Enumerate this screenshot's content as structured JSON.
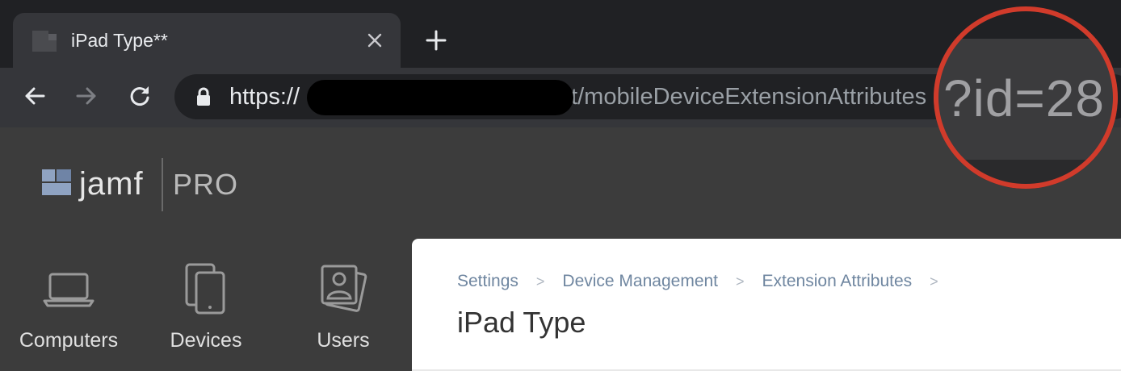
{
  "browser": {
    "tab": {
      "title": "iPad Type**",
      "favicon": "jamf-favicon"
    },
    "buttons": {
      "back_icon": "arrow-left-icon",
      "forward_icon": "arrow-right-icon",
      "reload_icon": "reload-icon",
      "close_icon": "close-icon",
      "new_tab_icon": "plus-icon"
    },
    "url": {
      "scheme": "https://",
      "redacted_host": "",
      "path": "t/mobileDeviceExtensionAttributes",
      "lock_icon": "lock-icon"
    }
  },
  "callout": {
    "text": "?id=28",
    "ring_color": "#d13b2b"
  },
  "app": {
    "logo": {
      "word": "jamf",
      "pro": "PRO"
    },
    "nav": [
      {
        "label": "Computers",
        "icon": "laptop-icon"
      },
      {
        "label": "Devices",
        "icon": "mobile-devices-icon"
      },
      {
        "label": "Users",
        "icon": "users-icon"
      }
    ],
    "breadcrumb": [
      "Settings",
      "Device Management",
      "Extension Attributes"
    ],
    "breadcrumb_separator": ">",
    "page_title": "iPad Type"
  },
  "colors": {
    "tabstrip": "#202124",
    "toolbar": "#35363a",
    "app_background": "#3c3c3c",
    "breadcrumb": "#6f86a0",
    "logo_mark": "#8fa3c2"
  }
}
